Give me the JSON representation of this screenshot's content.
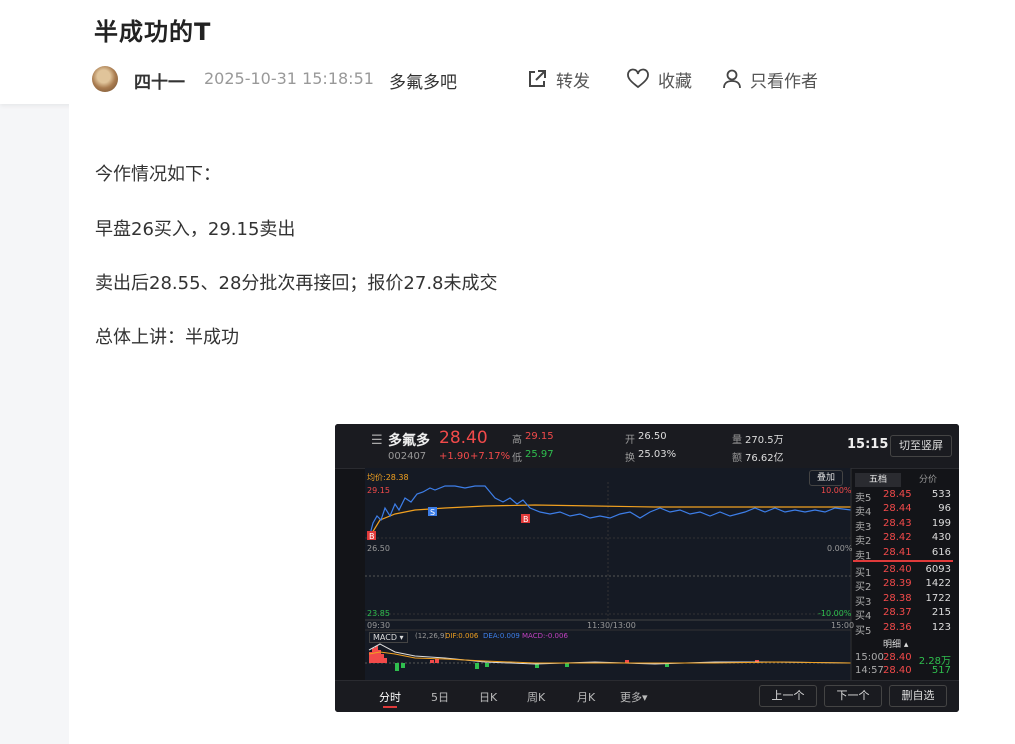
{
  "post": {
    "title": "半成功的T",
    "author": "四十一",
    "time": "2025-10-31 15:18:51",
    "bar": "多氟多吧"
  },
  "actions": {
    "share": "转发",
    "favorite": "收藏",
    "only_author": "只看作者"
  },
  "paragraphs": [
    "今作情况如下：",
    "早盘26买入，29.15卖出",
    "卖出后28.55、28分批次再接回；报价27.8未成交",
    "总体上讲：半成功"
  ],
  "stock": {
    "name": "多氟多",
    "code": "002407",
    "price": "28.40",
    "change": "+1.90",
    "change_pct": "+7.17%",
    "high_label": "高",
    "high": "29.15",
    "low_label": "低",
    "low": "25.97",
    "open_label": "开",
    "open": "26.50",
    "turnover_label": "换",
    "turnover": "25.03%",
    "volume_label": "量",
    "volume": "270.5万",
    "amount_label": "额",
    "amount": "76.62亿",
    "clock": "15:15",
    "switch_btn": "切至竖屏",
    "avg_label": "均价:28.38",
    "overlay_btn": "叠加",
    "axis_top": "29.15",
    "axis_mid": "26.50",
    "axis_bottom": "23.85",
    "pct_top": "10.00%",
    "pct_mid": "0.00%",
    "pct_bottom": "-10.00%",
    "time_start": "09:30",
    "time_mid": "11:30/13:00",
    "time_end": "15:00",
    "macd_label": "MACD",
    "macd_params": "(12,26,9)",
    "dif": "DIF:0.006",
    "dea": "DEA:0.009",
    "macd_val": "MACD:-0.006",
    "tabs": [
      "分时",
      "5日",
      "日K",
      "周K",
      "月K",
      "更多"
    ],
    "prev_btn": "上一个",
    "next_btn": "下一个",
    "watch_btn": "删自选",
    "ob_tabs": [
      "五档",
      "分价"
    ],
    "detail_label": "明细",
    "asks": [
      {
        "label": "卖5",
        "price": "28.45",
        "qty": "533"
      },
      {
        "label": "卖4",
        "price": "28.44",
        "qty": "96"
      },
      {
        "label": "卖3",
        "price": "28.43",
        "qty": "199"
      },
      {
        "label": "卖2",
        "price": "28.42",
        "qty": "430"
      },
      {
        "label": "卖1",
        "price": "28.41",
        "qty": "616"
      }
    ],
    "bids": [
      {
        "label": "买1",
        "price": "28.40",
        "qty": "6093"
      },
      {
        "label": "买2",
        "price": "28.39",
        "qty": "1422"
      },
      {
        "label": "买3",
        "price": "28.38",
        "qty": "1722"
      },
      {
        "label": "买4",
        "price": "28.37",
        "qty": "215"
      },
      {
        "label": "买5",
        "price": "28.36",
        "qty": "123"
      }
    ],
    "ticks": [
      {
        "time": "15:00",
        "price": "28.40",
        "qty": "2.28万"
      },
      {
        "time": "14:57",
        "price": "28.40",
        "qty": "517"
      }
    ],
    "marker_b": "B",
    "marker_s": "S"
  },
  "colors": {
    "up": "#f24a4a",
    "down": "#2fbf4e",
    "price_line": "#3d7ee8",
    "avg_line": "#f0a020"
  }
}
